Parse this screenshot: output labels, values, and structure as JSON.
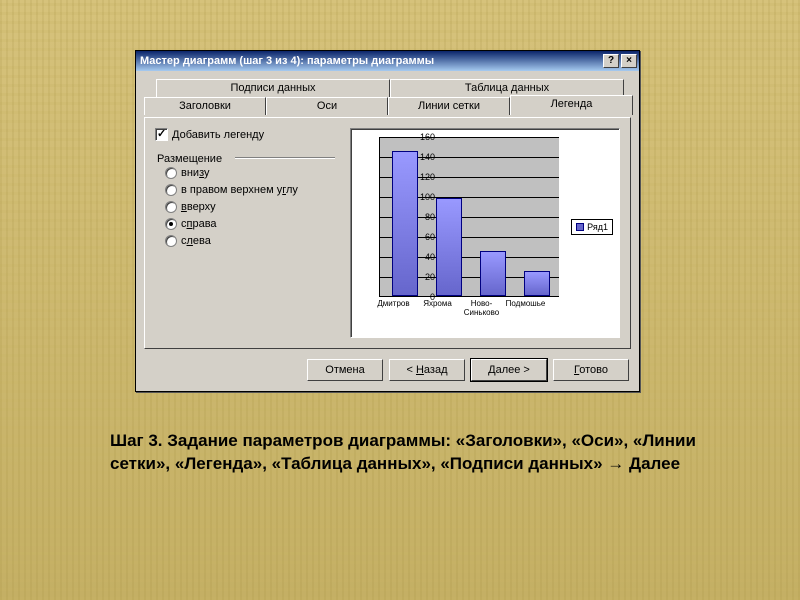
{
  "titlebar": {
    "title": "Мастер диаграмм (шаг 3 из 4): параметры диаграммы",
    "help": "?",
    "close": "×"
  },
  "tabs": {
    "row1": {
      "data_labels": "Подписи данных",
      "data_table": "Таблица данных"
    },
    "row2": {
      "titles": "Заголовки",
      "axes": "Оси",
      "gridlines": "Линии сетки",
      "legend": "Легенда"
    }
  },
  "legend_panel": {
    "show_legend": "Добавить легенду",
    "placement_label": "Размещение",
    "radios": {
      "bottom": "внизу",
      "corner": "в правом верхнем углу",
      "top": "вверху",
      "right": "справа",
      "left": "слева"
    },
    "selected": "right"
  },
  "chart_data": {
    "type": "bar",
    "categories": [
      "Дмитров",
      "Яхрома",
      "Ново-Синьково",
      "Подмошье"
    ],
    "values": [
      145,
      98,
      45,
      25
    ],
    "series_name": "Ряд1",
    "ylim": [
      0,
      160
    ],
    "yticks": [
      0,
      20,
      40,
      60,
      80,
      100,
      120,
      140,
      160
    ]
  },
  "buttons": {
    "cancel": "Отмена",
    "back": "< Назад",
    "next": "Далее >",
    "finish": "Готово"
  },
  "caption": "Шаг 3. Задание параметров диаграммы: «Заголовки», «Оси», «Линии сетки», «Легенда», «Таблица данных»,  «Подписи данных» → Далее"
}
